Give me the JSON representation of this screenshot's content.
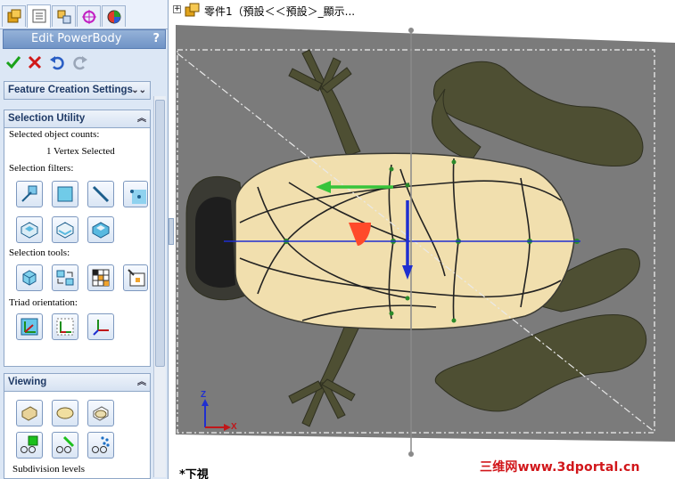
{
  "panel": {
    "tabs": [
      {
        "icon": "feature-manager-icon",
        "active": false
      },
      {
        "icon": "property-manager-icon",
        "active": true
      },
      {
        "icon": "configuration-manager-icon",
        "active": false
      },
      {
        "icon": "dimxpert-icon",
        "active": false
      },
      {
        "icon": "display-manager-icon",
        "active": false
      }
    ],
    "title": "Edit PowerBody",
    "help_label": "?",
    "actions": [
      "ok-check-icon",
      "cancel-x-icon",
      "undo-icon",
      "redo-icon"
    ],
    "feature_section": {
      "title": "Feature Creation Settings"
    },
    "selection_section": {
      "title": "Selection Utility",
      "counts_label": "Selected object counts:",
      "counts_value": "1 Vertex Selected",
      "filters_label": "Selection filters:",
      "tools_label": "Selection tools:",
      "triad_label": "Triad orientation:"
    },
    "viewing_section": {
      "title": "Viewing",
      "subdiv_label": "Subdivision levels"
    }
  },
  "viewport": {
    "tree_text": "零件1（預設＜＜預設＞_顯示...",
    "tree_expander": "+",
    "view_name": "*下視",
    "watermark": "三维网www.3dportal.cn",
    "triad": {
      "z_label": "Z",
      "x_label": "X"
    }
  },
  "colors": {
    "panel_bg": "#dce7f5",
    "header_blue": "#6f93c6",
    "background_gray": "#7b7b7b",
    "frog_green": "#4e4f33",
    "body_cream": "#f1dfae",
    "axis_blue": "#1f2fd0",
    "handle_green": "#37c43a",
    "vertex_red": "#ff4a2a",
    "watermark_red": "#d1161a"
  }
}
